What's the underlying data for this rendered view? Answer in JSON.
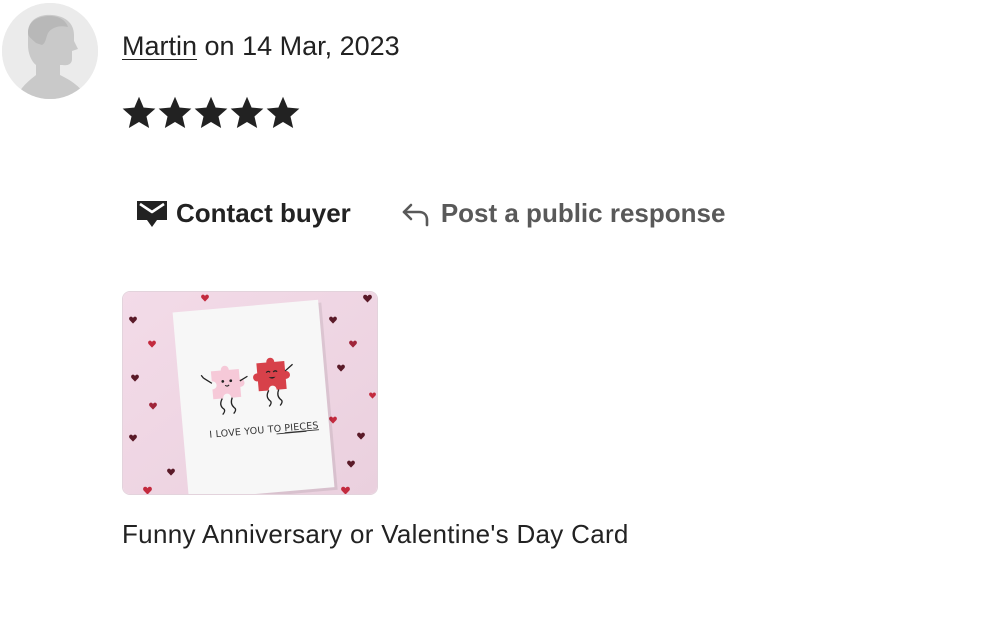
{
  "review": {
    "reviewer_name": "Martin",
    "date_text": "on 14 Mar, 2023",
    "rating": 5,
    "rating_max": 5
  },
  "actions": {
    "contact_label": "Contact buyer",
    "contact_icon": "envelope-chat-icon",
    "respond_label": "Post a public response",
    "respond_icon": "reply-arrow-icon"
  },
  "listing": {
    "title": "Funny Anniversary or Valentine's Day Card",
    "card_text_prefix": "I LOVE YOU TO",
    "card_text_emphasis": "PIECES"
  },
  "colors": {
    "text": "#222222",
    "muted": "#595959",
    "thumb_bg": "#f1d9e6",
    "puzzle_pink": "#f6c9d8",
    "puzzle_red": "#d7414a",
    "heart_dark": "#5a1a28",
    "heart_red": "#c32a3e"
  }
}
